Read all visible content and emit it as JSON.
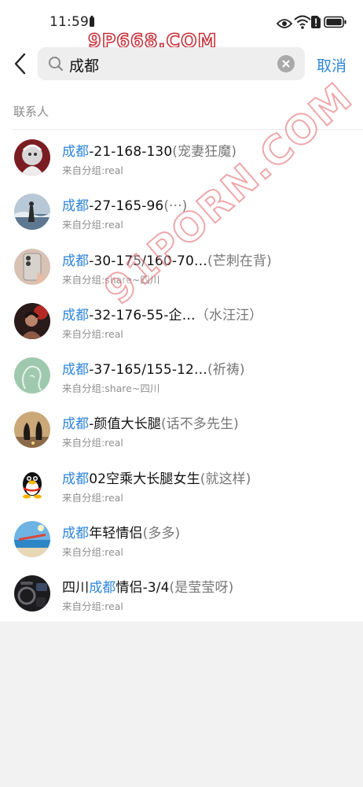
{
  "status_bar": {
    "time": "11:59"
  },
  "watermarks": {
    "top": "9P668.COM",
    "diagonal": "91PORN.COM"
  },
  "search": {
    "query": "成都",
    "cancel_label": "取消"
  },
  "section": {
    "title": "联系人"
  },
  "contacts": [
    {
      "name_parts": [
        {
          "text": "成都",
          "highlight": true
        },
        {
          "text": "-21-168-130",
          "highlight": false
        }
      ],
      "remark": "(宠妻狂魔)",
      "group": "来自分组:real",
      "avatar": "avatar-red-figure-icon"
    },
    {
      "name_parts": [
        {
          "text": "成都",
          "highlight": true
        },
        {
          "text": "-27-165-96",
          "highlight": false
        }
      ],
      "remark": "(···)",
      "group": "来自分组:real",
      "avatar": "avatar-sky-water-icon"
    },
    {
      "name_parts": [
        {
          "text": "成都",
          "highlight": true
        },
        {
          "text": "-30-175/160-70…",
          "highlight": false
        }
      ],
      "remark": "(芒刺在背)",
      "group": "来自分组:share~四川",
      "avatar": "avatar-phone-selfie-icon"
    },
    {
      "name_parts": [
        {
          "text": "成都",
          "highlight": true
        },
        {
          "text": "-32-176-55-企…",
          "highlight": false
        }
      ],
      "remark": "（水汪汪）",
      "group": "来自分组:real",
      "avatar": "avatar-dark-portrait-icon"
    },
    {
      "name_parts": [
        {
          "text": "成都",
          "highlight": true
        },
        {
          "text": "-37-165/155-12…",
          "highlight": false
        }
      ],
      "remark": "(祈祷)",
      "group": "来自分组:share~四川",
      "avatar": "avatar-green-silhouette-icon"
    },
    {
      "name_parts": [
        {
          "text": "成都",
          "highlight": true
        },
        {
          "text": "-颜值大长腿",
          "highlight": false
        }
      ],
      "remark": "(话不多先生)",
      "group": "来自分组:real",
      "avatar": "avatar-penguin-sunset-icon"
    },
    {
      "name_parts": [
        {
          "text": "成都",
          "highlight": true
        },
        {
          "text": "02空乘大长腿女生",
          "highlight": false
        }
      ],
      "remark": "(就这样)",
      "group": "来自分组:real",
      "avatar": "avatar-qq-penguin-icon"
    },
    {
      "name_parts": [
        {
          "text": "成都",
          "highlight": true
        },
        {
          "text": "年轻情侣",
          "highlight": false
        }
      ],
      "remark": "(多多)",
      "group": "来自分组:real",
      "avatar": "avatar-beach-icon"
    },
    {
      "name_parts": [
        {
          "text": "四川",
          "highlight": false
        },
        {
          "text": "成都",
          "highlight": true
        },
        {
          "text": "情侣-3/4",
          "highlight": false
        }
      ],
      "remark": "(是莹莹呀)",
      "group": "来自分组:real",
      "avatar": "avatar-car-interior-icon"
    }
  ],
  "colors": {
    "highlight": "#2f86d8",
    "background": "#ffffff",
    "lower_background": "#f2f2f2"
  }
}
